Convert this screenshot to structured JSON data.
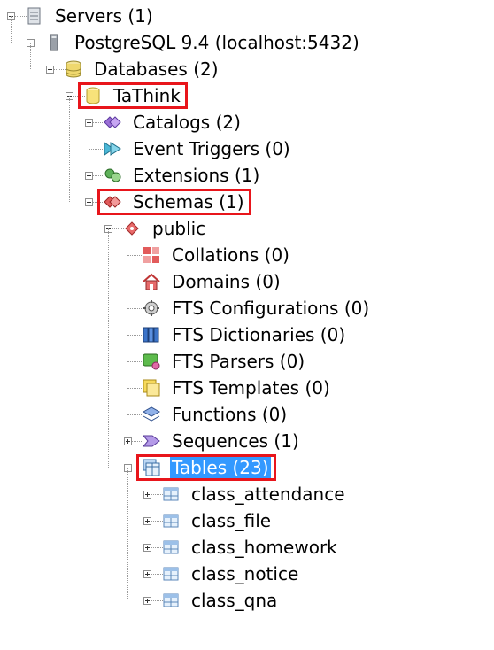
{
  "tree": {
    "nodes": [
      {
        "label": "Servers (1)",
        "icon": "server-icon",
        "level": 0,
        "toggle": "minus"
      },
      {
        "label": "PostgreSQL 9.4 (localhost:5432)",
        "icon": "postgresql-server-icon",
        "level": 1,
        "toggle": "minus"
      },
      {
        "label": "Databases (2)",
        "icon": "databases-icon",
        "level": 2,
        "toggle": "minus"
      },
      {
        "label": "TaThink",
        "icon": "database-icon",
        "level": 3,
        "toggle": "minus",
        "highlight": true
      },
      {
        "label": "Catalogs (2)",
        "icon": "catalogs-icon",
        "level": 4,
        "toggle": "plus"
      },
      {
        "label": "Event Triggers (0)",
        "icon": "event-triggers-icon",
        "level": 4,
        "toggle": "none"
      },
      {
        "label": "Extensions (1)",
        "icon": "extensions-icon",
        "level": 4,
        "toggle": "plus"
      },
      {
        "label": "Schemas (1)",
        "icon": "schemas-icon",
        "level": 4,
        "toggle": "minus",
        "highlight": true
      },
      {
        "label": "public",
        "icon": "schema-icon",
        "level": 5,
        "toggle": "minus"
      },
      {
        "label": "Collations (0)",
        "icon": "collations-icon",
        "level": 6,
        "toggle": "none"
      },
      {
        "label": "Domains (0)",
        "icon": "domains-icon",
        "level": 6,
        "toggle": "none"
      },
      {
        "label": "FTS Configurations (0)",
        "icon": "fts-configurations-icon",
        "level": 6,
        "toggle": "none"
      },
      {
        "label": "FTS Dictionaries (0)",
        "icon": "fts-dictionaries-icon",
        "level": 6,
        "toggle": "none"
      },
      {
        "label": "FTS Parsers (0)",
        "icon": "fts-parsers-icon",
        "level": 6,
        "toggle": "none"
      },
      {
        "label": "FTS Templates (0)",
        "icon": "fts-templates-icon",
        "level": 6,
        "toggle": "none"
      },
      {
        "label": "Functions (0)",
        "icon": "functions-icon",
        "level": 6,
        "toggle": "none"
      },
      {
        "label": "Sequences (1)",
        "icon": "sequences-icon",
        "level": 6,
        "toggle": "plus"
      },
      {
        "label": "Tables (23)",
        "icon": "tables-icon",
        "level": 6,
        "toggle": "minus",
        "highlight": true,
        "selected": true
      },
      {
        "label": "class_attendance",
        "icon": "table-icon",
        "level": 7,
        "toggle": "plus"
      },
      {
        "label": "class_file",
        "icon": "table-icon",
        "level": 7,
        "toggle": "plus"
      },
      {
        "label": "class_homework",
        "icon": "table-icon",
        "level": 7,
        "toggle": "plus"
      },
      {
        "label": "class_notice",
        "icon": "table-icon",
        "level": 7,
        "toggle": "plus"
      },
      {
        "label": "class_qna",
        "icon": "table-icon",
        "level": 7,
        "toggle": "plus"
      }
    ]
  },
  "colors": {
    "highlight_border": "#e8151b",
    "selection": "#3399ff",
    "tree_line": "#9a9a9a"
  }
}
